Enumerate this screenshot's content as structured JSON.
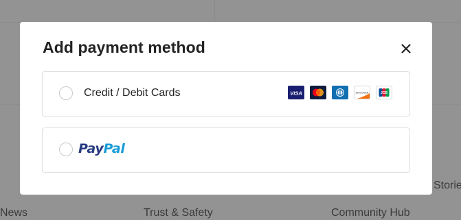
{
  "background": {
    "footer_links": [
      "News",
      "Trust & Safety",
      "Community Hub",
      "Stories"
    ]
  },
  "modal": {
    "title": "Add payment method",
    "close_icon": "close-icon",
    "options": [
      {
        "label": "Credit / Debit Cards",
        "selected": false,
        "card_brands": [
          "VISA",
          "Mastercard",
          "Diners Club",
          "DISCOVER",
          "JCB"
        ]
      },
      {
        "label": "PayPal",
        "label_part1": "Pay",
        "label_part2": "Pal",
        "selected": false
      }
    ]
  },
  "colors": {
    "overlay": "#939393",
    "paypal_dark": "#253b80",
    "paypal_light": "#179bd7",
    "visa": "#1a1f71",
    "border": "#dedede"
  }
}
